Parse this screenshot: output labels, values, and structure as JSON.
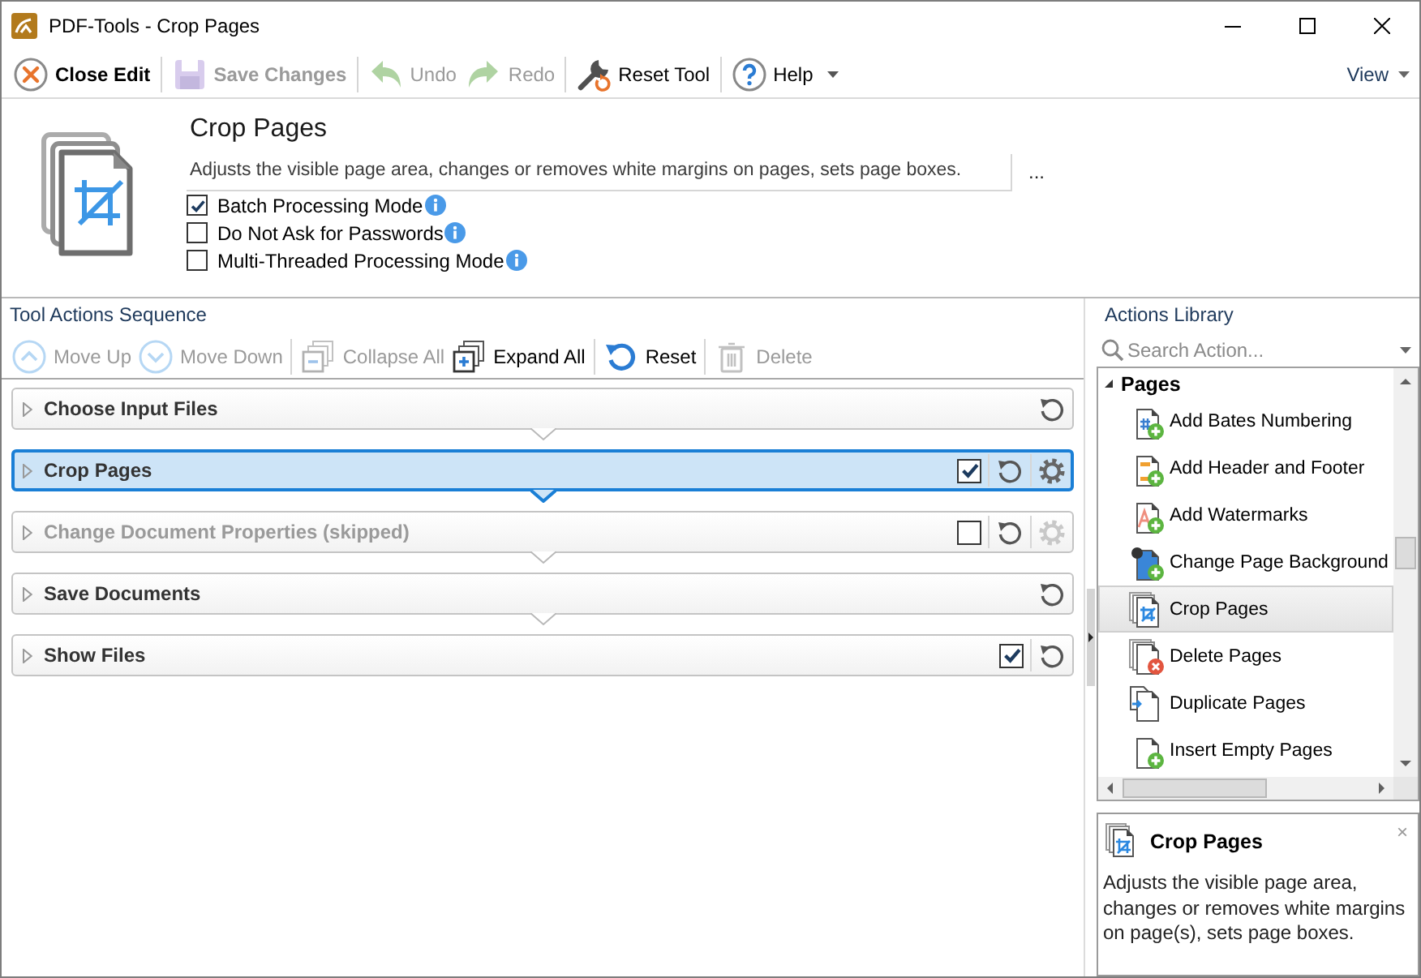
{
  "window": {
    "title": "PDF-Tools - Crop Pages"
  },
  "toolbar": {
    "buttons": [
      {
        "label": "Close Edit",
        "disabled": false
      },
      {
        "label": "Save Changes",
        "disabled": true
      },
      {
        "label": "Undo",
        "disabled": true
      },
      {
        "label": "Redo",
        "disabled": true
      },
      {
        "label": "Reset Tool",
        "disabled": false
      },
      {
        "label": "Help",
        "disabled": false
      }
    ],
    "view_menu": "View"
  },
  "tool_header": {
    "title": "Crop Pages",
    "description": "Adjusts the visible page area, changes or removes white margins on pages, sets page boxes.",
    "more_button": "...",
    "options": [
      {
        "label": "Batch Processing Mode",
        "checked": true
      },
      {
        "label": "Do Not Ask for Passwords",
        "checked": false
      },
      {
        "label": "Multi-Threaded Processing Mode",
        "checked": false
      }
    ]
  },
  "sequence": {
    "title": "Tool Actions Sequence",
    "toolbar": [
      {
        "label": "Move Up",
        "disabled": true
      },
      {
        "label": "Move Down",
        "disabled": true
      },
      {
        "label": "Collapse All",
        "disabled": true
      },
      {
        "label": "Expand All",
        "disabled": false
      },
      {
        "label": "Reset",
        "disabled": false
      },
      {
        "label": "Delete",
        "disabled": true
      }
    ],
    "actions": [
      {
        "label": "Choose Input Files",
        "selected": false,
        "skipped": false,
        "settings": false
      },
      {
        "label": "Crop Pages",
        "selected": true,
        "skipped": false,
        "checked": true,
        "settings": true
      },
      {
        "label": "Change Document Properties (skipped)",
        "selected": false,
        "skipped": true,
        "checked": false,
        "settings": true
      },
      {
        "label": "Save Documents",
        "selected": false,
        "skipped": false,
        "settings": false
      },
      {
        "label": "Show Files",
        "selected": false,
        "skipped": false,
        "checked": true,
        "settings": false
      }
    ]
  },
  "library": {
    "title": "Actions Library",
    "search": {
      "placeholder": "Search Action..."
    },
    "groups": [
      {
        "label": "Pages",
        "expanded": true,
        "children": [
          {
            "label": "Add Bates Numbering",
            "selected": false
          },
          {
            "label": "Add Header and Footer",
            "selected": false
          },
          {
            "label": "Add Watermarks",
            "selected": false
          },
          {
            "label": "Change Page Background",
            "selected": false
          },
          {
            "label": "Crop Pages",
            "selected": true
          },
          {
            "label": "Delete Pages",
            "selected": false
          },
          {
            "label": "Duplicate Pages",
            "selected": false
          },
          {
            "label": "Insert Empty Pages",
            "selected": false
          }
        ]
      }
    ]
  },
  "info_panel": {
    "title": "Crop Pages",
    "close": "×",
    "description": "Adjusts the visible page area, changes or removes white margins on page(s), sets page boxes."
  }
}
